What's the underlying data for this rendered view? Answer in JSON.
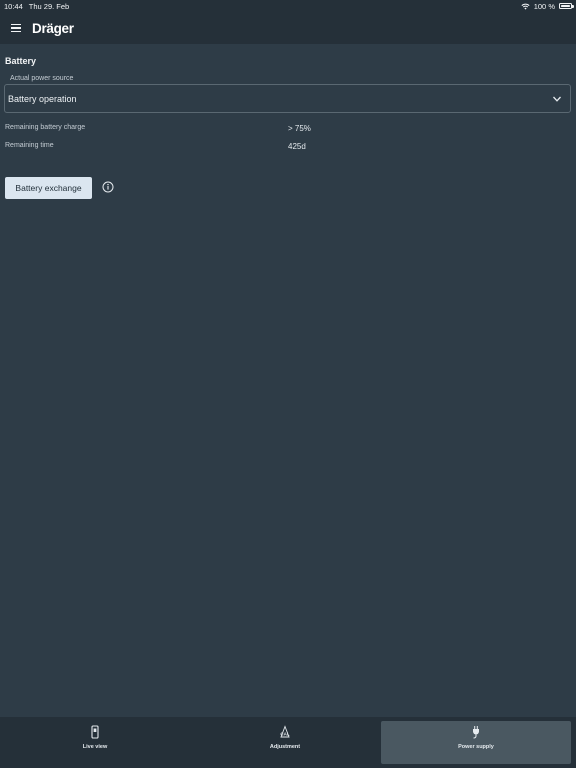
{
  "status": {
    "time": "10:44",
    "date": "Thu 29. Feb",
    "battery": "100 %"
  },
  "header": {
    "brand": "Dräger"
  },
  "battery": {
    "title": "Battery",
    "source_label": "Actual power source",
    "source_value": "Battery operation",
    "charge_label": "Remaining battery charge",
    "charge_value": "> 75%",
    "time_label": "Remaining time",
    "time_value": "425d",
    "exchange_button": "Battery exchange"
  },
  "tabs": [
    {
      "label": "Live view",
      "icon": "device-icon"
    },
    {
      "label": "Adjustment",
      "icon": "cal-icon"
    },
    {
      "label": "Power supply",
      "icon": "plug-icon",
      "active": true
    }
  ]
}
